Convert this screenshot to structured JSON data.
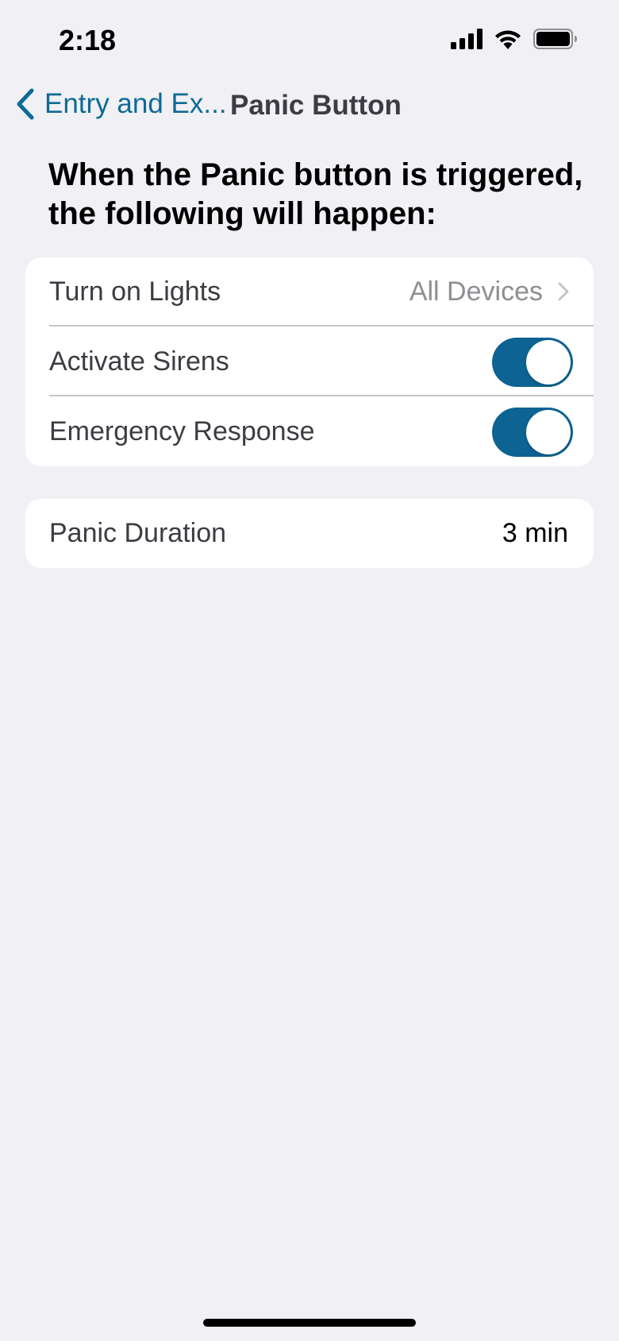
{
  "status_bar": {
    "time": "2:18"
  },
  "nav": {
    "back_label": "Entry and Ex...",
    "title": "Panic Button"
  },
  "headline": "When the Panic button is triggered, the following will happen:",
  "actions": [
    {
      "label": "Turn on Lights",
      "value": "All Devices"
    },
    {
      "label": "Activate Sirens",
      "enabled": true
    },
    {
      "label": "Emergency Response",
      "enabled": true
    }
  ],
  "duration": {
    "label": "Panic Duration",
    "value": "3 min"
  },
  "colors": {
    "accent": "#0d6391",
    "background": "#f0f0f5"
  }
}
